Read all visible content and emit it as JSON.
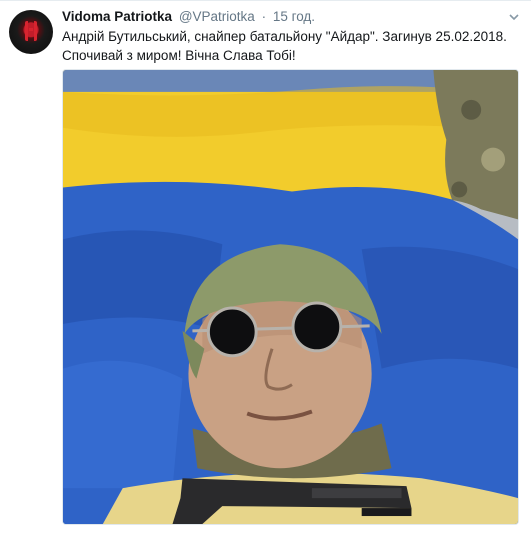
{
  "tweet": {
    "display_name": "Vidoma Patriotka",
    "handle": "@VPatriotka",
    "separator": "·",
    "time": "15 год.",
    "text_line_1": "Андрій Бутильський, снайпер батальйону \"Айдар\". Загинув 25.02.2018.",
    "text_line_2": "Спочивай з миром! Вічна Слава Тобі!"
  },
  "icons": {
    "avatar": "avatar-image",
    "more": "chevron-down-icon",
    "photo": "tweet-photo"
  },
  "colors": {
    "name": "#14171a",
    "secondary": "#657786",
    "border": "#e1e8ed",
    "flag_yellow": "#ffd700",
    "flag_blue": "#0057b7"
  }
}
